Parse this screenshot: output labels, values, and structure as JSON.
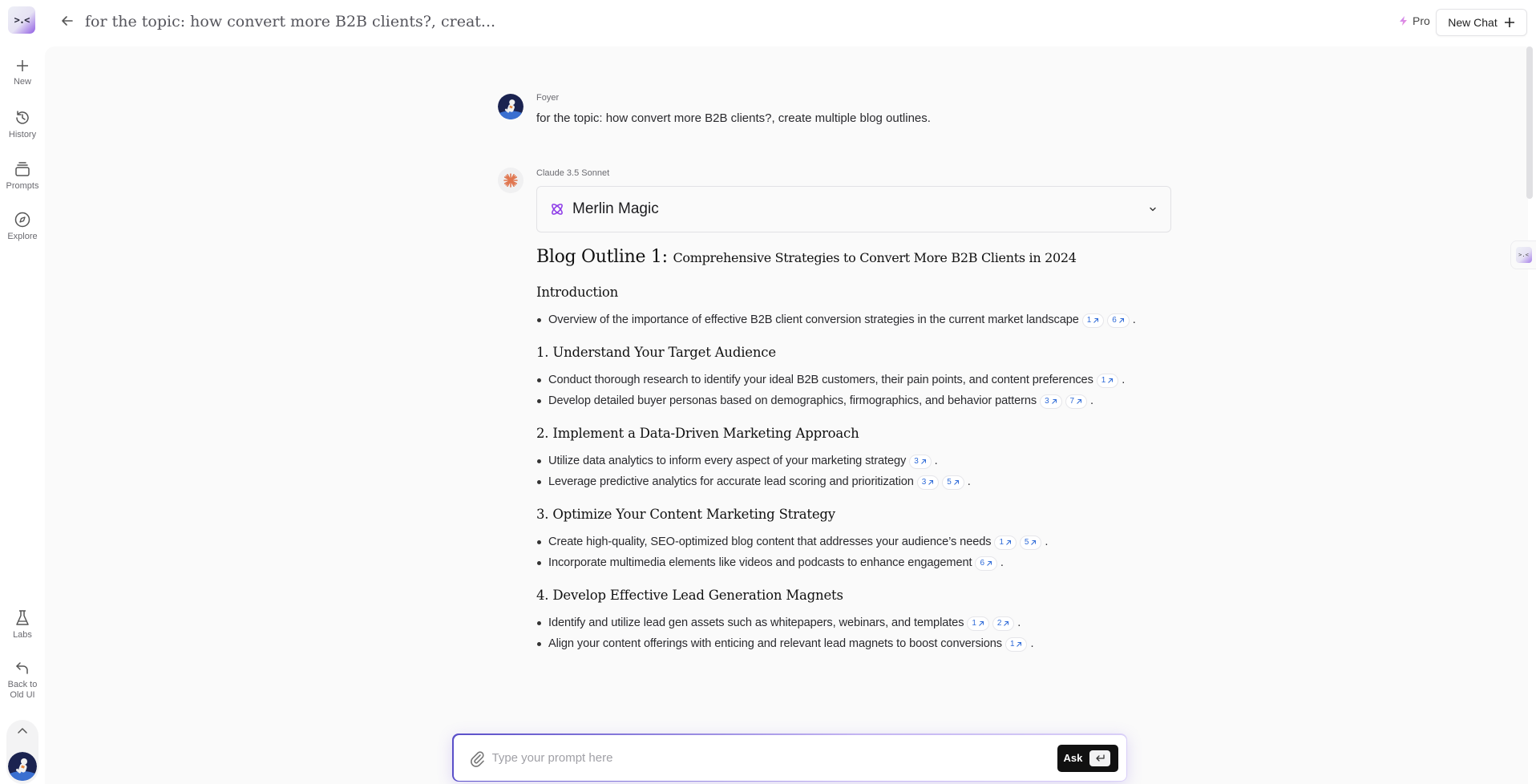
{
  "header": {
    "logo_text": ">.<",
    "title": "for the topic: how convert more B2B clients?, creat...",
    "pro_label": "Pro",
    "new_chat_label": "New Chat"
  },
  "sidebar": {
    "items": [
      {
        "label": "New",
        "icon": "plus-icon"
      },
      {
        "label": "History",
        "icon": "history-icon"
      },
      {
        "label": "Prompts",
        "icon": "prompts-icon"
      },
      {
        "label": "Explore",
        "icon": "compass-icon"
      }
    ],
    "bottom_items": [
      {
        "label": "Labs",
        "icon": "flask-icon"
      },
      {
        "label": "Back to Old UI",
        "icon": "undo-arrow-icon"
      }
    ]
  },
  "conversation": {
    "user": {
      "name": "Foyer",
      "message": "for the topic: how convert more B2B clients?, create multiple blog outlines."
    },
    "assistant": {
      "model": "Claude 3.5 Sonnet",
      "mode_label": "Merlin Magic",
      "outline": {
        "title_main": "Blog Outline 1:",
        "title_sub": "Comprehensive Strategies to Convert More B2B Clients in 2024",
        "sections": [
          {
            "heading": "Introduction",
            "bullets": [
              {
                "text": "Overview of the importance of effective B2B client conversion strategies in the current market landscape",
                "citations": [
                  "1",
                  "6"
                ]
              }
            ]
          },
          {
            "heading": "1. Understand Your Target Audience",
            "bullets": [
              {
                "text": "Conduct thorough research to identify your ideal B2B customers, their pain points, and content preferences",
                "citations": [
                  "1"
                ]
              },
              {
                "text": "Develop detailed buyer personas based on demographics, firmographics, and behavior patterns",
                "citations": [
                  "3",
                  "7"
                ]
              }
            ]
          },
          {
            "heading": "2. Implement a Data-Driven Marketing Approach",
            "bullets": [
              {
                "text": "Utilize data analytics to inform every aspect of your marketing strategy",
                "citations": [
                  "3"
                ]
              },
              {
                "text": "Leverage predictive analytics for accurate lead scoring and prioritization",
                "citations": [
                  "3",
                  "5"
                ]
              }
            ]
          },
          {
            "heading": "3. Optimize Your Content Marketing Strategy",
            "bullets": [
              {
                "text": "Create high-quality, SEO-optimized blog content that addresses your audience’s needs",
                "citations": [
                  "1",
                  "5"
                ]
              },
              {
                "text": "Incorporate multimedia elements like videos and podcasts to enhance engagement",
                "citations": [
                  "6"
                ]
              }
            ]
          },
          {
            "heading": "4. Develop Effective Lead Generation Magnets",
            "bullets": [
              {
                "text": "Identify and utilize lead gen assets such as whitepapers, webinars, and templates",
                "citations": [
                  "1",
                  "2"
                ]
              },
              {
                "text": "Align your content offerings with enticing and relevant lead magnets to boost conversions",
                "citations": [
                  "1"
                ]
              }
            ]
          }
        ]
      }
    }
  },
  "prompt": {
    "placeholder": "Type your prompt here",
    "value": "",
    "ask_label": "Ask"
  },
  "colors": {
    "accent_purple": "#8f5be3",
    "citation_blue": "#2f6bd8",
    "claude_orange": "#e0764f"
  }
}
